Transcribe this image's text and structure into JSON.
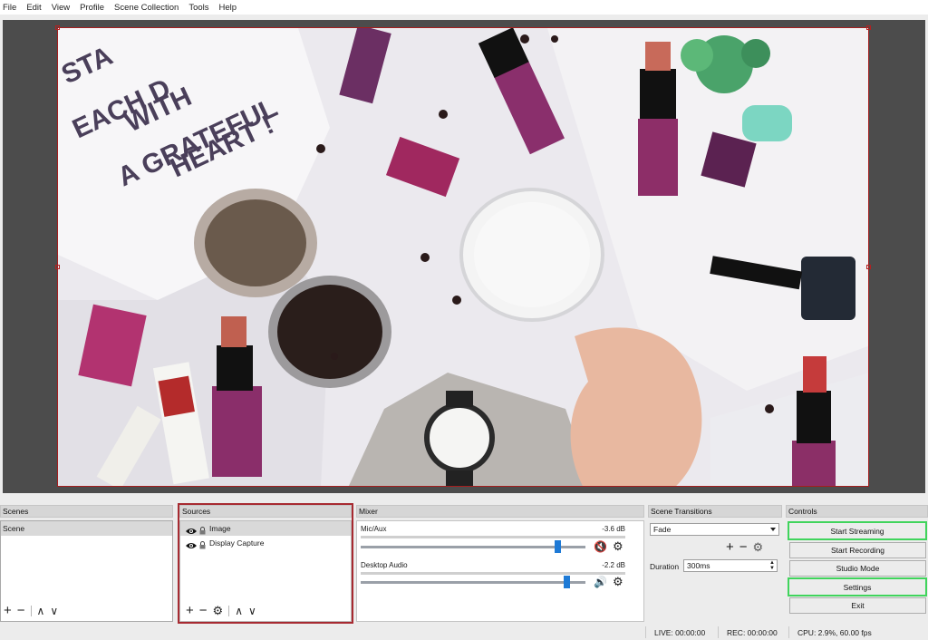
{
  "menu": [
    "File",
    "Edit",
    "View",
    "Profile",
    "Scene Collection",
    "Tools",
    "Help"
  ],
  "preview": {
    "canvas_text": [
      "STA",
      "EACH D",
      "WITH",
      "A GRATEFUL",
      "HEART !"
    ]
  },
  "scenes": {
    "title": "Scenes",
    "items": [
      "Scene"
    ]
  },
  "sources": {
    "title": "Sources",
    "items": [
      {
        "label": "Image",
        "icon": "eye-icon",
        "lock": "lock-icon"
      },
      {
        "label": "Display Capture",
        "icon": "eye-icon",
        "lock": "lock-icon"
      }
    ]
  },
  "mixer": {
    "title": "Mixer",
    "channels": [
      {
        "name": "Mic/Aux",
        "db": "-3.6 dB",
        "muted": true,
        "level": 0.88
      },
      {
        "name": "Desktop Audio",
        "db": "-2.2 dB",
        "muted": false,
        "level": 0.92
      }
    ]
  },
  "transitions": {
    "title": "Scene Transitions",
    "selected": "Fade",
    "duration_label": "Duration",
    "duration_value": "300ms"
  },
  "controls": {
    "title": "Controls",
    "start_streaming": "Start Streaming",
    "start_recording": "Start Recording",
    "studio_mode": "Studio Mode",
    "settings": "Settings",
    "exit": "Exit"
  },
  "status": {
    "live": "LIVE: 00:00:00",
    "rec": "REC: 00:00:00",
    "cpu": "CPU: 2.9%, 60.00 fps"
  },
  "colors": {
    "highlight_green": "#40d45c",
    "highlight_red": "#a72a31",
    "mute_red": "#d9252a",
    "slider_blue": "#1e7ad6"
  }
}
